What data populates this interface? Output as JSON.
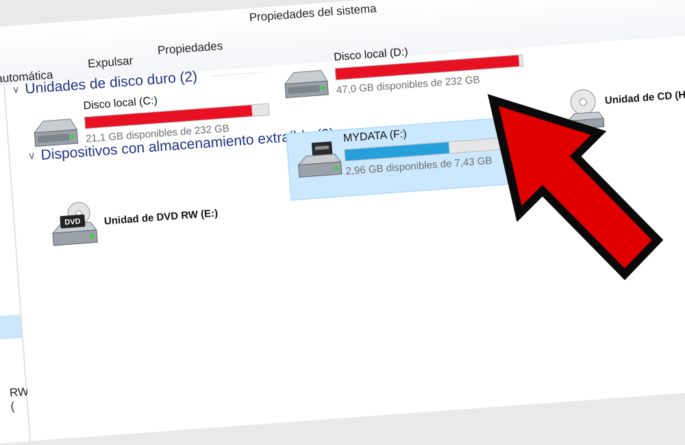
{
  "toolbar": {
    "system_properties": "Propiedades del sistema",
    "autoplay": "automática",
    "eject": "Expulsar",
    "properties": "Propiedades"
  },
  "navpane": {
    "truncated_item": "RW ("
  },
  "groups": {
    "hard_drives": "Unidades de disco duro (2)",
    "removable": "Dispositivos con almacenamiento extraíble (3)"
  },
  "drives": {
    "c": {
      "name": "Disco local (C:)",
      "space": "21,1 GB disponibles de 232 GB",
      "used_fraction": 0.91,
      "bar_color": "#e81123",
      "icon": "hard-drive-icon"
    },
    "d": {
      "name": "Disco local (D:)",
      "space": "47,0 GB disponibles de 232 GB",
      "used_fraction": 0.98,
      "bar_color": "#e81123",
      "icon": "hard-drive-icon"
    },
    "f": {
      "name": "MYDATA (F:)",
      "space": "2,96 GB disponibles de 7,43 GB",
      "used_fraction": 0.6,
      "bar_color": "#26a0da",
      "icon": "usb-drive-icon"
    },
    "e": {
      "name": "Unidad de DVD RW (E:)",
      "icon": "dvd-drive-icon",
      "icon_label": "DVD"
    },
    "h": {
      "name": "Unidad de CD (H",
      "icon": "cd-drive-icon"
    }
  },
  "colors": {
    "group_header": "#1e3287",
    "selection": "#cce8ff",
    "arrow": "#e00000"
  }
}
